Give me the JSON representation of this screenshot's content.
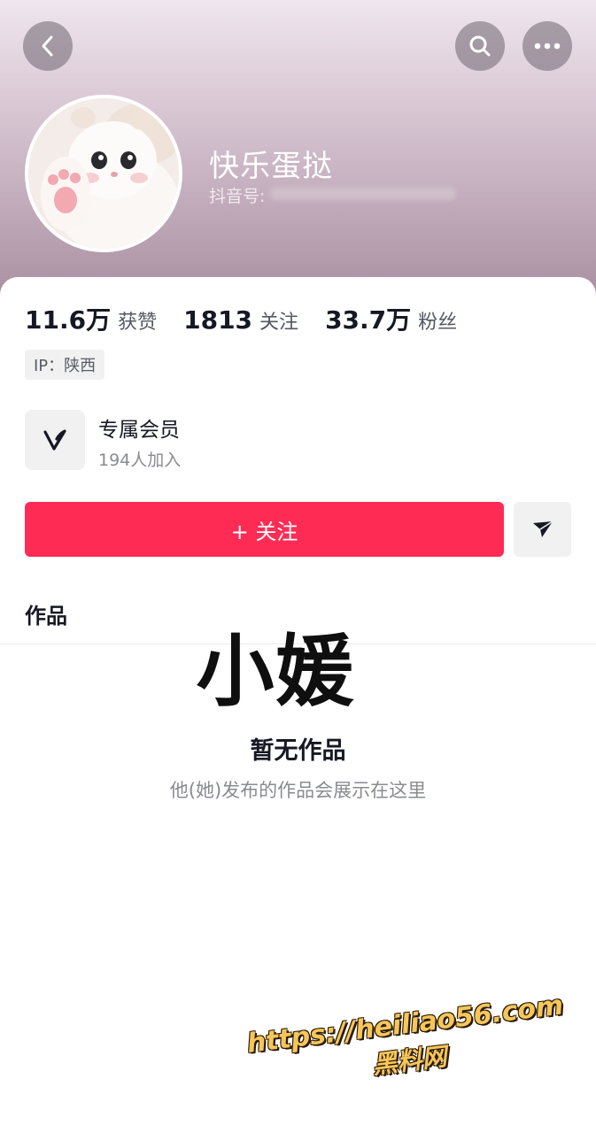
{
  "profile": {
    "nickname": "快乐蛋挞",
    "douyin_id_label": "抖音号:"
  },
  "stats": [
    {
      "value": "11.6万",
      "label": "获赞"
    },
    {
      "value": "1813",
      "label": "关注"
    },
    {
      "value": "33.7万",
      "label": "粉丝"
    }
  ],
  "ip_location": "IP：陕西",
  "membership": {
    "title": "专属会员",
    "subtitle": "194人加入"
  },
  "actions": {
    "follow_label": "+ 关注"
  },
  "tabs": {
    "works": "作品"
  },
  "overlay_text": "小媛",
  "empty_state": {
    "title": "暂无作品",
    "subtitle": "他(她)发布的作品会展示在这里"
  },
  "watermark": {
    "url": "https://heiliao56.com",
    "name": "黑料网"
  },
  "colors": {
    "accent": "#fe2c55",
    "header_gradient_top": "#efe6ee",
    "header_gradient_bottom": "#a88ea0"
  },
  "icons": {
    "back": "chevron-left-icon",
    "search": "search-icon",
    "more": "more-dots-icon",
    "member": "v-logo-icon",
    "share": "share-arrow-icon"
  }
}
